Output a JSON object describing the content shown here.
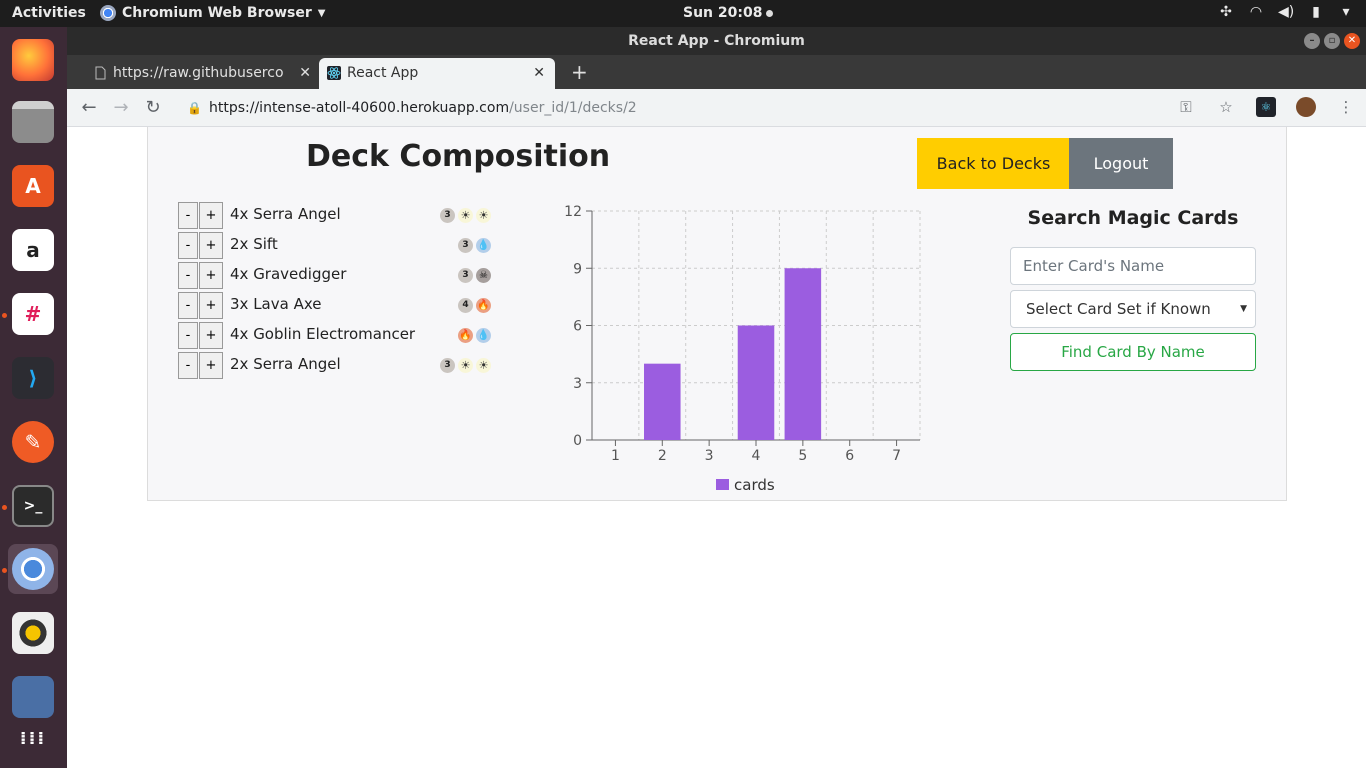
{
  "topbar": {
    "activities": "Activities",
    "app_name": "Chromium Web Browser",
    "clock": "Sun 20:08"
  },
  "window": {
    "title": "React App - Chromium"
  },
  "tabs": [
    {
      "label": "https://raw.githubuserco",
      "active": false
    },
    {
      "label": "React App",
      "active": true
    }
  ],
  "address": {
    "host": "https://intense-atoll-40600.herokuapp.com",
    "path": "/user_id/1/decks/2"
  },
  "page": {
    "title": "Deck Composition",
    "back_button": "Back to Decks",
    "logout_button": "Logout"
  },
  "cards": [
    {
      "name": "4x Serra Angel",
      "mana": [
        {
          "type": "generic",
          "text": "3"
        },
        {
          "type": "white",
          "text": "☀"
        },
        {
          "type": "white",
          "text": "☀"
        }
      ]
    },
    {
      "name": "2x Sift",
      "mana": [
        {
          "type": "generic",
          "text": "3"
        },
        {
          "type": "blue",
          "text": "💧"
        }
      ]
    },
    {
      "name": "4x Gravedigger",
      "mana": [
        {
          "type": "generic",
          "text": "3"
        },
        {
          "type": "black",
          "text": "☠"
        }
      ]
    },
    {
      "name": "3x Lava Axe",
      "mana": [
        {
          "type": "generic",
          "text": "4"
        },
        {
          "type": "red",
          "text": "🔥"
        }
      ]
    },
    {
      "name": "4x Goblin Electromancer",
      "mana": [
        {
          "type": "red",
          "text": "🔥"
        },
        {
          "type": "blue",
          "text": "💧"
        }
      ]
    },
    {
      "name": "2x Serra Angel",
      "mana": [
        {
          "type": "generic",
          "text": "3"
        },
        {
          "type": "white",
          "text": "☀"
        },
        {
          "type": "white",
          "text": "☀"
        }
      ]
    }
  ],
  "card_controls": {
    "minus": "-",
    "plus": "+"
  },
  "chart_data": {
    "type": "bar",
    "categories": [
      "1",
      "2",
      "3",
      "4",
      "5",
      "6",
      "7"
    ],
    "series": [
      {
        "name": "cards",
        "values": [
          0,
          4,
          0,
          6,
          9,
          0,
          0
        ],
        "color": "#9b5de0"
      }
    ],
    "yticks": [
      0,
      3,
      6,
      9,
      12
    ],
    "ylim": [
      0,
      12
    ],
    "grid": true,
    "legend": "bottom"
  },
  "search": {
    "title": "Search Magic Cards",
    "name_placeholder": "Enter Card's Name",
    "set_select": "Select Card Set if Known",
    "find_button": "Find Card By Name"
  }
}
